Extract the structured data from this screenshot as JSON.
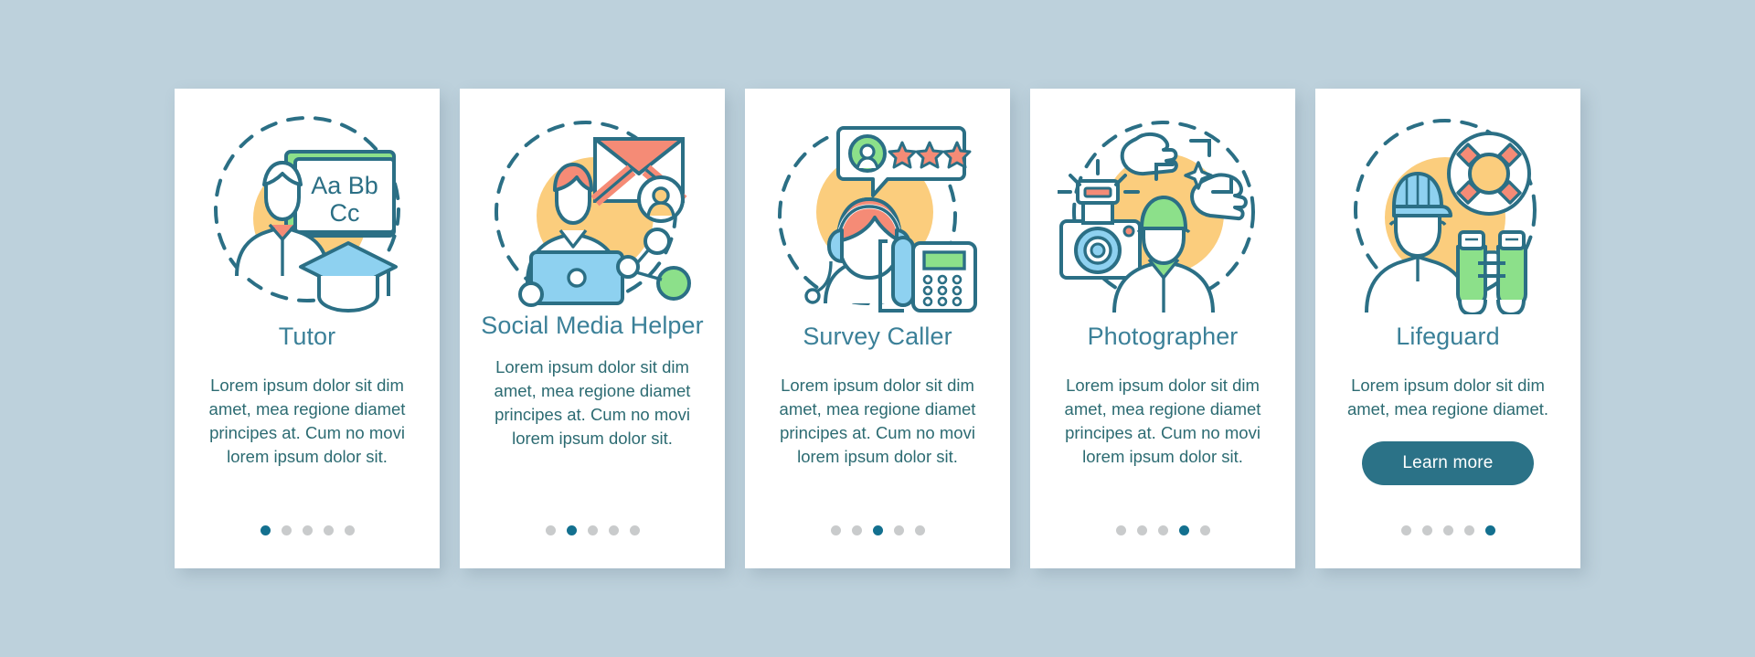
{
  "theme": {
    "background": "#bdd1dc",
    "card_background": "#ffffff",
    "title_color": "#3b8098",
    "body_color": "#2c6b72",
    "accent": "#13708f",
    "button_background": "#2b7287",
    "button_text_color": "#ffffff",
    "dot_inactive": "#c9cbcc",
    "illustration_outline": "#2b6f85",
    "illustration_yellow": "#fbcd7d",
    "illustration_green": "#8ce08a",
    "illustration_blue": "#8ed1f0",
    "illustration_coral": "#f58b76"
  },
  "screens": [
    {
      "id": "tutor",
      "icon": "tutor-chalkboard-icon",
      "title": "Tutor",
      "description": "Lorem ipsum dolor sit dim amet, mea regione diamet principes at. Cum no movi lorem ipsum dolor sit.",
      "cta": null,
      "pagination": {
        "total": 5,
        "active_index": 0
      }
    },
    {
      "id": "social-media-helper",
      "icon": "social-media-laptop-icon",
      "title": "Social Media Helper",
      "description": "Lorem ipsum dolor sit dim amet, mea regione diamet principes at. Cum no movi lorem ipsum dolor sit.",
      "cta": null,
      "pagination": {
        "total": 5,
        "active_index": 1
      }
    },
    {
      "id": "survey-caller",
      "icon": "survey-caller-headset-icon",
      "title": "Survey Caller",
      "description": "Lorem ipsum dolor sit dim amet, mea regione diamet principes at. Cum no movi lorem ipsum dolor sit.",
      "cta": null,
      "pagination": {
        "total": 5,
        "active_index": 2
      }
    },
    {
      "id": "photographer",
      "icon": "photographer-camera-icon",
      "title": "Photographer",
      "description": "Lorem ipsum dolor sit dim amet, mea regione diamet principes at. Cum no movi lorem ipsum dolor sit.",
      "cta": null,
      "pagination": {
        "total": 5,
        "active_index": 3
      }
    },
    {
      "id": "lifeguard",
      "icon": "lifeguard-ring-icon",
      "title": "Lifeguard",
      "description": "Lorem ipsum dolor sit dim amet, mea regione diamet.",
      "cta": "Learn more",
      "pagination": {
        "total": 5,
        "active_index": 4
      }
    }
  ],
  "illustration_text": {
    "chalkboard_line1": "Aa Bb",
    "chalkboard_line2": "Cc"
  }
}
